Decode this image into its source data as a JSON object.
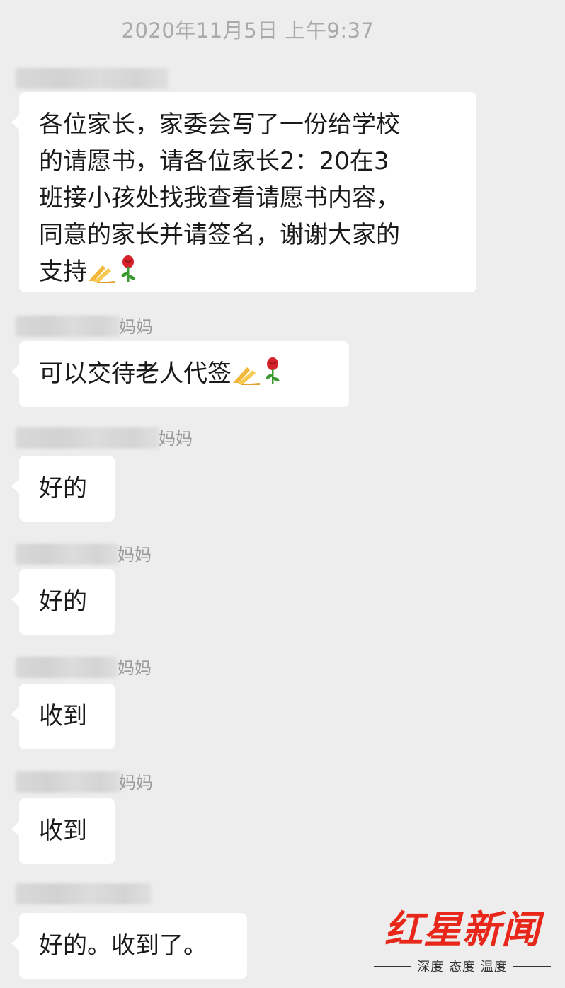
{
  "timestamp": "2020年11月5日 上午9:37",
  "messages": [
    {
      "sender_suffix": "",
      "text_lines": [
        "各位家长，家委会写了一份给学校",
        "的请愿书，请各位家长2：20在3",
        "班接小孩处找我查看请愿书内容，",
        "同意的家长并请签名，谢谢大家的",
        "支持"
      ],
      "emojis": [
        "praying-hands-icon",
        "rose-icon"
      ]
    },
    {
      "sender_suffix": "妈妈",
      "text": "可以交待老人代签",
      "emojis": [
        "praying-hands-icon",
        "rose-icon"
      ]
    },
    {
      "sender_suffix": "妈妈",
      "text": "好的"
    },
    {
      "sender_suffix": "妈妈",
      "text": "好的"
    },
    {
      "sender_suffix": "妈妈",
      "text": "收到"
    },
    {
      "sender_suffix": "妈妈",
      "text": "收到"
    },
    {
      "sender_suffix": "",
      "text": "好的。收到了。"
    }
  ],
  "watermark": {
    "logo": "红星新闻",
    "slogan": "深度 态度 温度",
    "color": "#e8261a"
  }
}
